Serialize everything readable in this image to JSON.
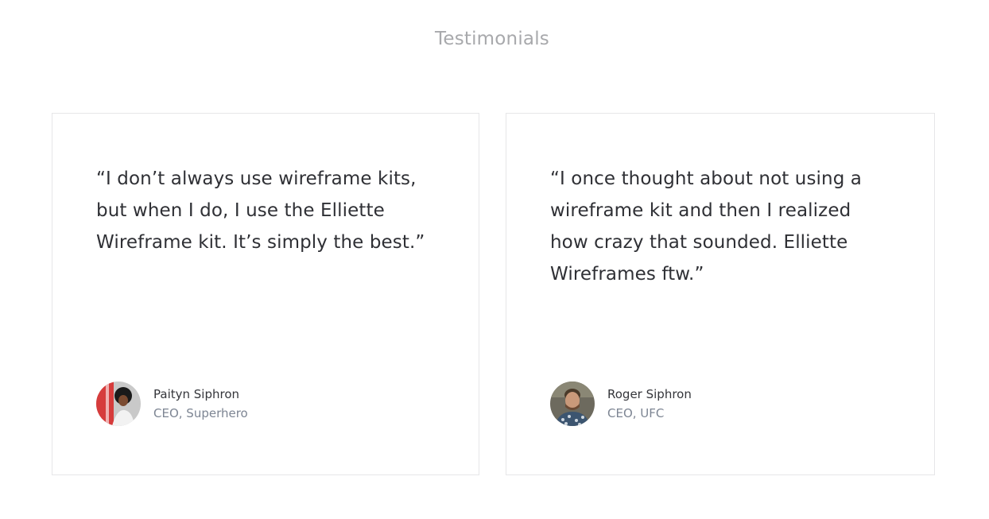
{
  "section": {
    "title": "Testimonials"
  },
  "testimonials": [
    {
      "quote": "“I don’t always use wireframe kits, but when I do, I use the Elliette Wireframe kit. It’s simply the best.”",
      "name": "Paityn Siphron",
      "role": "CEO, Superhero",
      "avatar": "avatar-woman-red-background"
    },
    {
      "quote": "“I once thought about not using a wireframe kit and then I realized how crazy that sounded. Elliette Wireframes ftw.”",
      "name": "Roger Siphron",
      "role": "CEO, UFC",
      "avatar": "avatar-man-patterned-shirt"
    }
  ],
  "colors": {
    "title": "#a8a9ac",
    "quote_text": "#2f3035",
    "name_text": "#34353a",
    "role_text": "#7d8593",
    "card_border": "#e6e6e8"
  }
}
